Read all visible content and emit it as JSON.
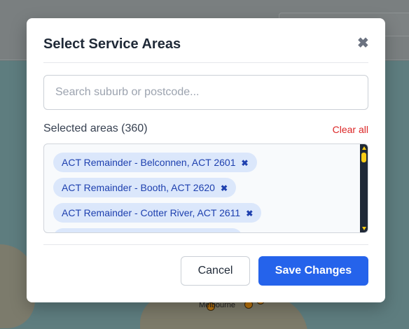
{
  "background": {
    "map_label": "Melbourne"
  },
  "modal": {
    "title": "Select Service Areas",
    "close_icon": "close-icon",
    "search": {
      "placeholder": "Search suburb or postcode...",
      "value": ""
    },
    "selected_label": "Selected areas (360)",
    "clear_all_label": "Clear all",
    "chips": [
      {
        "label": "ACT Remainder - Belconnen, ACT 2601"
      },
      {
        "label": "ACT Remainder - Booth, ACT 2620"
      },
      {
        "label": "ACT Remainder - Cotter River, ACT 2611"
      }
    ],
    "chip_remove_glyph": "✖",
    "cancel_label": "Cancel",
    "save_label": "Save Changes"
  },
  "colors": {
    "primary": "#2563eb",
    "danger": "#dc2626",
    "chip_bg": "#dbe7fb",
    "chip_text": "#1e40af",
    "scrollbar_accent": "#facc15"
  }
}
